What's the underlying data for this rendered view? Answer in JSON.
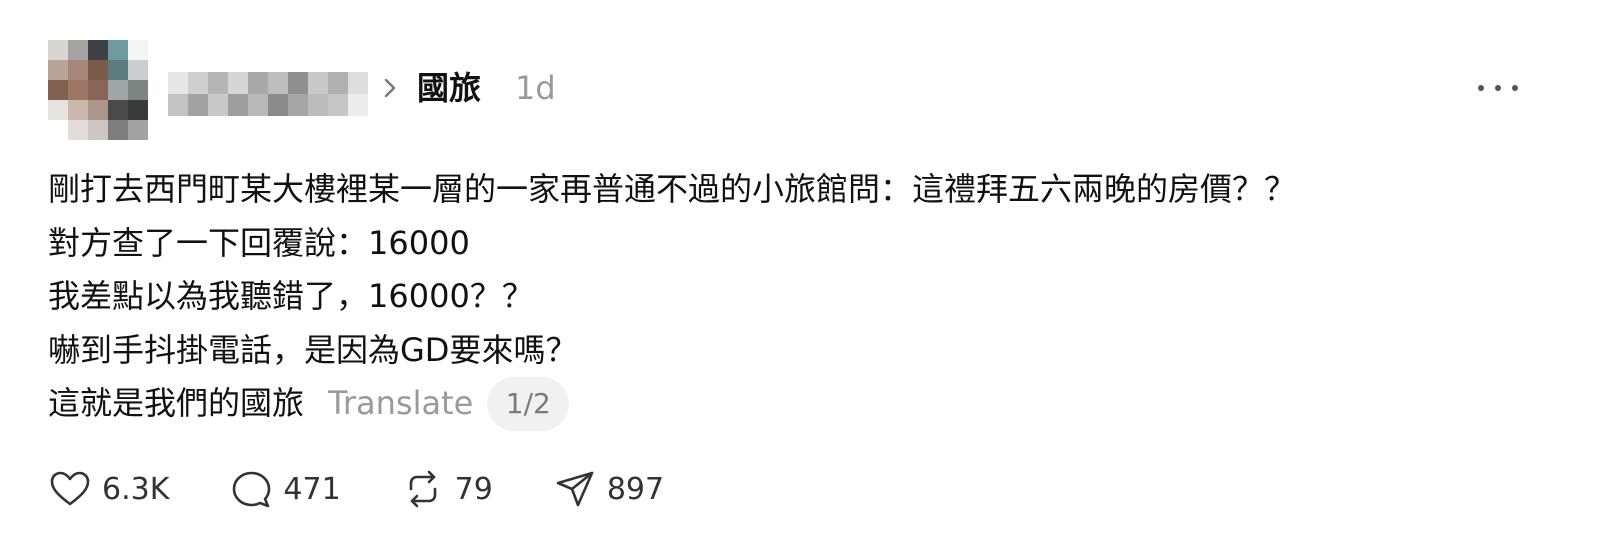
{
  "post": {
    "community": "國旅",
    "time": "1d",
    "lines": [
      "剛打去西門町某大樓裡某一層的一家再普通不過的小旅館問：這禮拜五六兩晚的房價？？",
      "對方查了一下回覆說：16000",
      "我差點以為我聽錯了，16000？？",
      "嚇到手抖掛電話，是因為GD要來嗎？",
      "這就是我們的國旅"
    ],
    "translate_label": "Translate",
    "page_indicator": "1/2"
  },
  "actions": {
    "likes": "6.3K",
    "replies": "471",
    "reposts": "79",
    "shares": "897"
  },
  "colors": {
    "text": "#111111",
    "muted": "#9a9a9a",
    "badge_bg": "#f1f1f1"
  },
  "icons": [
    "chevron-right-icon",
    "more-icon",
    "heart-icon",
    "comment-icon",
    "repost-icon",
    "send-icon"
  ]
}
